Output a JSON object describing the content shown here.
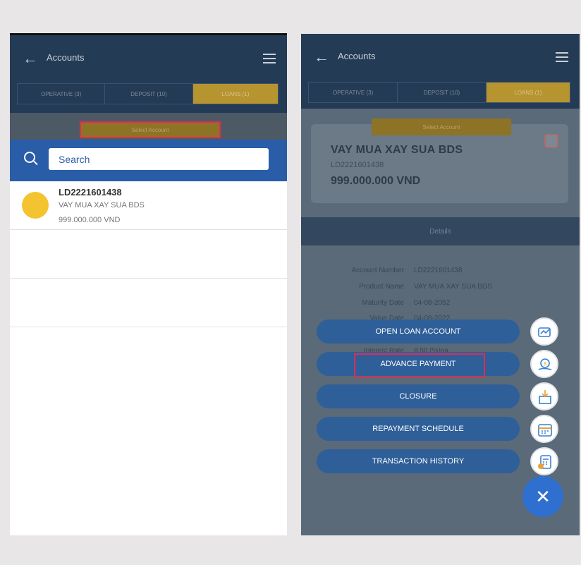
{
  "left": {
    "header": {
      "title": "Accounts"
    },
    "tabs": [
      {
        "label": "OPERATIVE (3)"
      },
      {
        "label": "DEPOSIT (10)"
      },
      {
        "label": "LOANS (1)"
      }
    ],
    "select_account": "Select Account",
    "search": {
      "placeholder": "Search"
    },
    "account": {
      "code": "LD2221601438",
      "name": "VAY MUA XAY SUA BDS",
      "amount": "999.000.000 VND"
    }
  },
  "right": {
    "header": {
      "title": "Accounts"
    },
    "tabs": [
      {
        "label": "OPERATIVE (3)"
      },
      {
        "label": "DEPOSIT (10)"
      },
      {
        "label": "LOANS (1)"
      }
    ],
    "select_account": "Select Account",
    "card": {
      "title": "VAY MUA XAY SUA BDS",
      "code": "LD2221601438",
      "amount": "999.000.000 VND"
    },
    "details_label": "Details",
    "details": [
      {
        "key": "Account Number",
        "value": "LD2221601438"
      },
      {
        "key": "Product Name",
        "value": "VAY MUA XAY SUA BDS"
      },
      {
        "key": "Maturity Date",
        "value": "04-08-2052"
      },
      {
        "key": "Value Date",
        "value": "04-08-2022"
      },
      {
        "key": "Interest Rate",
        "value": "8.50 (%)pa"
      }
    ],
    "actions": [
      {
        "label": "OPEN LOAN ACCOUNT",
        "icon": "open-loan-icon"
      },
      {
        "label": "ADVANCE PAYMENT",
        "icon": "money-bag-hand-icon"
      },
      {
        "label": "CLOSURE",
        "icon": "box-download-icon"
      },
      {
        "label": "REPAYMENT SCHEDULE",
        "icon": "calendar-icon"
      },
      {
        "label": "TRANSACTION HISTORY",
        "icon": "history-calculator-icon"
      }
    ],
    "close_symbol": "✕"
  },
  "colors": {
    "header": "#243b55",
    "tab_active": "#b69430",
    "accent_blue": "#2a5da7",
    "action_button": "#2f5f98",
    "highlight": "#e02c52",
    "avatar": "#f4c430"
  }
}
